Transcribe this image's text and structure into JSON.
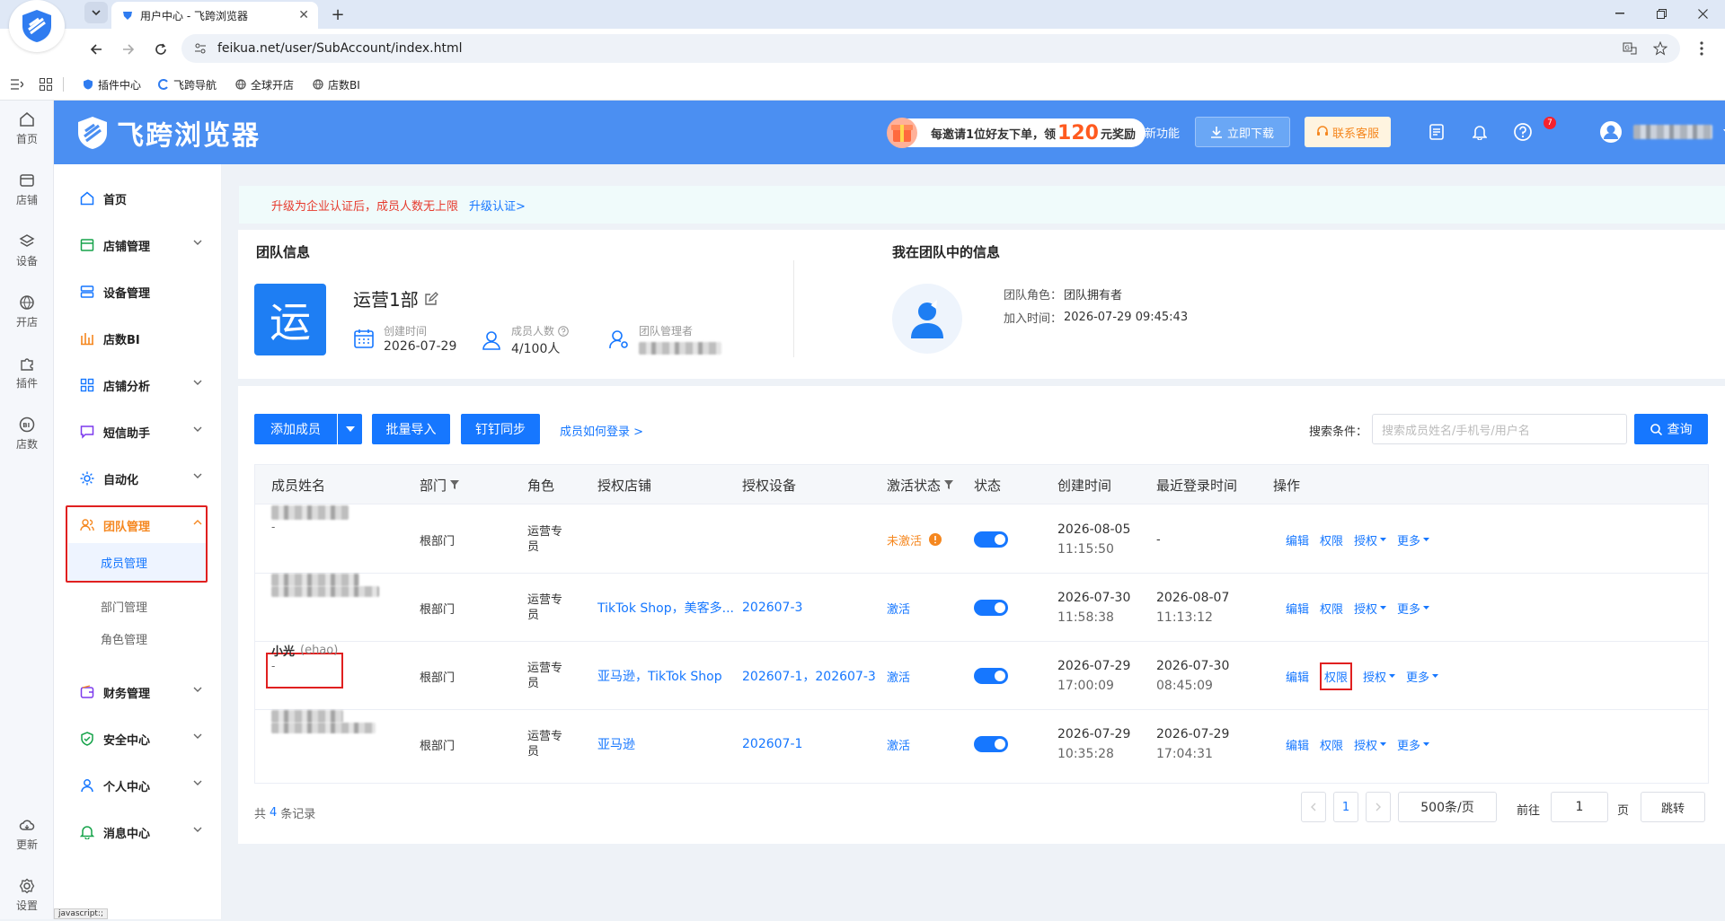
{
  "browser": {
    "tab_title": "用户中心 - 飞跨浏览器",
    "url": "feikua.net/user/SubAccount/index.html",
    "bookmarks": [
      "插件中心",
      "飞跨导航",
      "全球开店",
      "店数BI"
    ],
    "status_text": "javascript:;"
  },
  "header": {
    "brand": "飞跨浏览器",
    "promo_prefix": "每邀请1位好友下单，领",
    "promo_amount": "120",
    "promo_suffix": "元奖励",
    "new_feature": "新功能",
    "download": "立即下载",
    "service": "联系客服",
    "notify_count": "7"
  },
  "rail": [
    {
      "label": "首页",
      "icon": "home-icon"
    },
    {
      "label": "店铺",
      "icon": "store-icon"
    },
    {
      "label": "设备",
      "icon": "layers-icon"
    },
    {
      "label": "开店",
      "icon": "globe-icon"
    },
    {
      "label": "插件",
      "icon": "plugin-icon"
    },
    {
      "label": "店数",
      "icon": "bi-icon"
    },
    {
      "label": "更新",
      "icon": "cloud-icon"
    },
    {
      "label": "设置",
      "icon": "gear-icon"
    }
  ],
  "sidebar": {
    "home": "首页",
    "store_mgmt": "店铺管理",
    "device_mgmt": "设备管理",
    "store_bi": "店数BI",
    "store_analysis": "店铺分析",
    "sms": "短信助手",
    "automation": "自动化",
    "team_mgmt": "团队管理",
    "member_mgmt": "成员管理",
    "dept_mgmt": "部门管理",
    "role_mgmt": "角色管理",
    "finance": "财务管理",
    "security": "安全中心",
    "personal": "个人中心",
    "messages": "消息中心"
  },
  "notice": {
    "text": "升级为企业认证后，成员人数无上限",
    "link": "升级认证>"
  },
  "team": {
    "title": "团队信息",
    "avatar_char": "运",
    "name": "运营1部",
    "created_label": "创建时间",
    "created_value": "2026-07-29",
    "members_label": "成员人数",
    "members_value": "4/100人",
    "manager_label": "团队管理者"
  },
  "me": {
    "title": "我在团队中的信息",
    "role_label": "团队角色：",
    "role_value": "团队拥有者",
    "join_label": "加入时间：",
    "join_value": "2026-07-29 09:45:43"
  },
  "toolbar": {
    "add_member": "添加成员",
    "batch_import": "批量导入",
    "dingtalk_sync": "钉钉同步",
    "how_login": "成员如何登录 >",
    "search_label": "搜索条件：",
    "search_placeholder": "搜索成员姓名/手机号/用户名",
    "search_btn": "查询"
  },
  "table": {
    "columns": [
      "成员姓名",
      "部门",
      "角色",
      "授权店铺",
      "授权设备",
      "激活状态",
      "状态",
      "创建时间",
      "最近登录时间",
      "操作"
    ],
    "rows": [
      {
        "name": "",
        "sub": "-",
        "dept": "根部门",
        "role": "运营专员",
        "stores": "",
        "devices": "",
        "activation": "未激活",
        "created_date": "2026-08-05",
        "created_time": "11:15:50",
        "login_date": "-",
        "login_time": "",
        "enabled": true
      },
      {
        "name": "",
        "sub": "",
        "dept": "根部门",
        "role": "运营专员",
        "stores": "TikTok Shop，美客多...",
        "devices": "202607-3",
        "activation": "激活",
        "created_date": "2026-07-30",
        "created_time": "11:58:38",
        "login_date": "2026-08-07",
        "login_time": "11:13:12",
        "enabled": true
      },
      {
        "name": "小光",
        "username": "(ehao)",
        "sub": "-",
        "dept": "根部门",
        "role": "运营专员",
        "stores": "亚马逊，TikTok Shop",
        "devices": "202607-1，202607-3",
        "activation": "激活",
        "created_date": "2026-07-29",
        "created_time": "17:00:09",
        "login_date": "2026-07-30",
        "login_time": "08:45:09",
        "enabled": true
      },
      {
        "name": "",
        "sub": "",
        "dept": "根部门",
        "role": "运营专员",
        "stores": "亚马逊",
        "devices": "202607-1",
        "activation": "激活",
        "created_date": "2026-07-29",
        "created_time": "10:35:28",
        "login_date": "2026-07-29",
        "login_time": "17:04:31",
        "enabled": true
      }
    ],
    "op_edit": "编辑",
    "op_perm": "权限",
    "op_auth": "授权",
    "op_more": "更多"
  },
  "pagination": {
    "total_prefix": "共",
    "total": "4",
    "total_suffix": "条记录",
    "page": "1",
    "page_size": "500条/页",
    "goto_label": "前往",
    "goto_value": "1",
    "page_unit": "页",
    "jump": "跳转"
  },
  "colors": {
    "primary": "#1677ff",
    "header": "#4b8ff2",
    "warning": "#f5871f",
    "danger": "#e02020"
  }
}
